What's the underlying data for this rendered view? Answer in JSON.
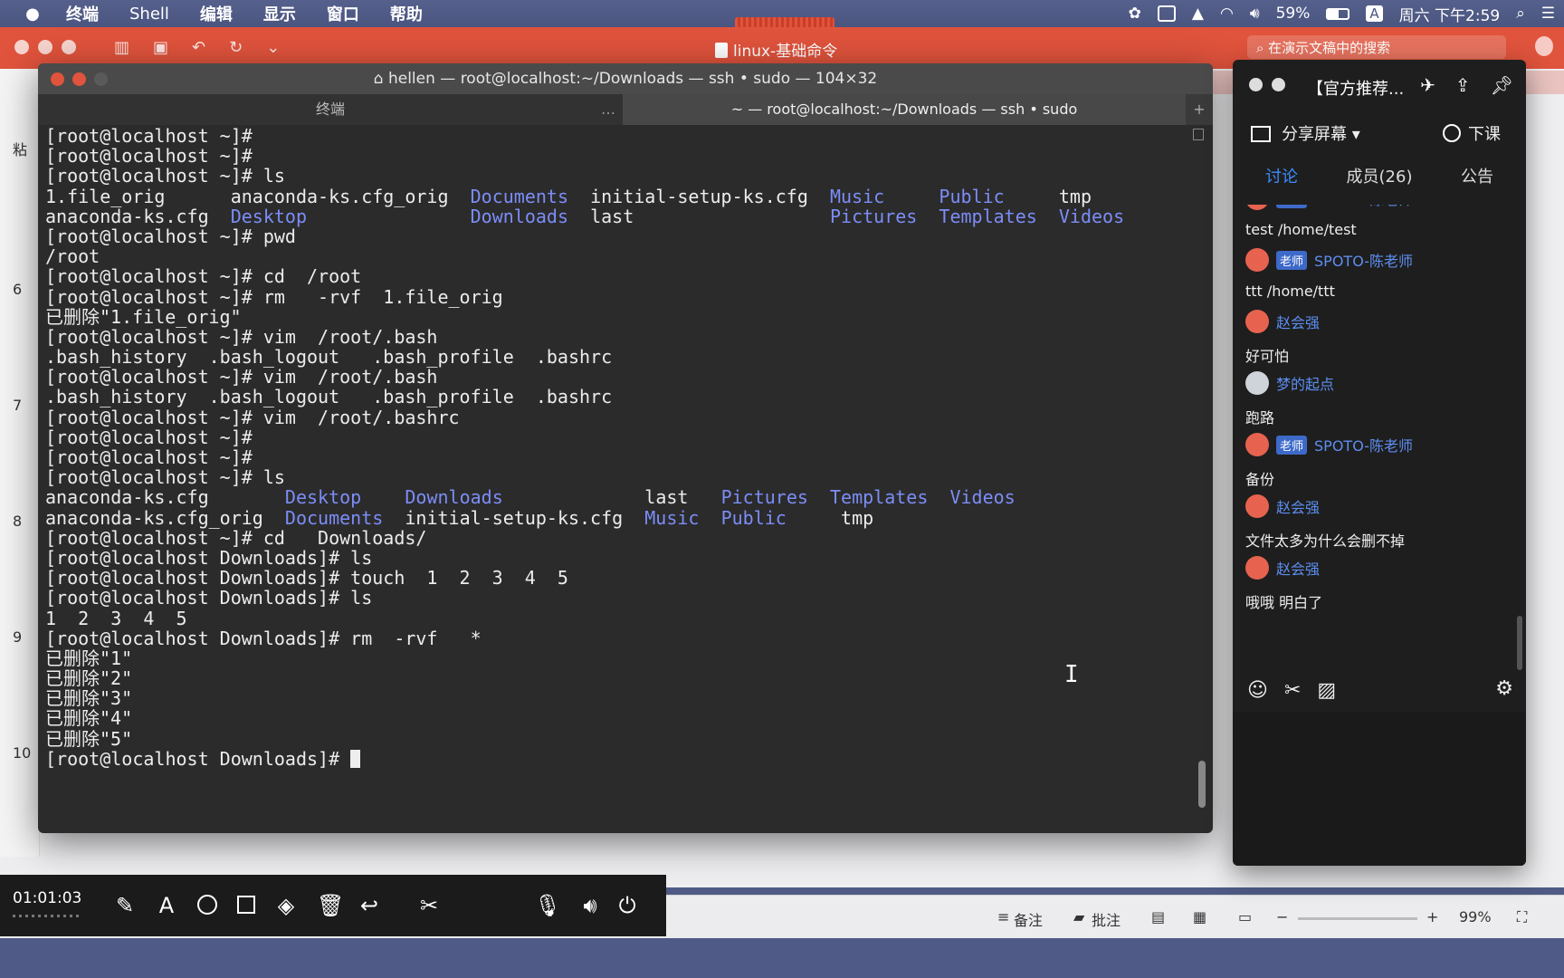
{
  "menubar": {
    "app": "终端",
    "items": [
      "Shell",
      "编辑",
      "显示",
      "窗口",
      "帮助"
    ],
    "battery": "59%",
    "input_method": "A",
    "clock": "周六 下午2:59"
  },
  "doc": {
    "title": "linux-基础命令",
    "search_placeholder": "在演示文稿中的搜索",
    "ruler_numbers": [
      "6",
      "7",
      "8",
      "9",
      "10"
    ],
    "left_char": "粘",
    "bottom": {
      "notes": "备注",
      "comments": "批注",
      "minus": "−",
      "plus": "+",
      "zoom": "99%"
    }
  },
  "terminal": {
    "title": "hellen — root@localhost:~/Downloads — ssh • sudo — 104×32",
    "tab_inactive": "终端",
    "tab_active": "~ — root@localhost:~/Downloads — ssh • sudo",
    "lines": [
      "[root@localhost ~]#",
      "[root@localhost ~]#",
      "[root@localhost ~]# ls",
      "1.file_orig      anaconda-ks.cfg_orig  <D>Documents</D>  initial-setup-ks.cfg  <D>Music</D>     <D>Public</D>     tmp",
      "anaconda-ks.cfg  <D>Desktop</D>               <D>Downloads</D>  last                  <D>Pictures</D>  <D>Templates</D>  <D>Videos</D>",
      "[root@localhost ~]# pwd",
      "/root",
      "[root@localhost ~]# cd  /root",
      "[root@localhost ~]# rm   -rvf  1.file_orig",
      "已删除\"1.file_orig\"",
      "[root@localhost ~]# vim  /root/.bash",
      ".bash_history  .bash_logout   .bash_profile  .bashrc",
      "[root@localhost ~]# vim  /root/.bash",
      ".bash_history  .bash_logout   .bash_profile  .bashrc",
      "[root@localhost ~]# vim  /root/.bashrc",
      "[root@localhost ~]#",
      "[root@localhost ~]#",
      "[root@localhost ~]# ls",
      "anaconda-ks.cfg       <D>Desktop</D>    <D>Downloads</D>             last   <D>Pictures</D>  <D>Templates</D>  <D>Videos</D>",
      "anaconda-ks.cfg_orig  <D>Documents</D>  initial-setup-ks.cfg  <D>Music</D>  <D>Public</D>     tmp",
      "[root@localhost ~]# cd   Downloads/",
      "[root@localhost Downloads]# ls",
      "[root@localhost Downloads]# touch  1  2  3  4  5",
      "[root@localhost Downloads]# ls",
      "1  2  3  4  5",
      "[root@localhost Downloads]# rm  -rvf   *",
      "已删除\"1\"",
      "已删除\"2\"",
      "已删除\"3\"",
      "已删除\"4\"",
      "已删除\"5\"",
      "[root@localhost Downloads]# <CURSOR>"
    ]
  },
  "chat": {
    "title": "【官方推荐...",
    "share_label": "分享屏幕",
    "end_label": "下课",
    "tabs": [
      "讨论",
      "成员(26)",
      "公告"
    ],
    "messages": [
      {
        "badge": "老师",
        "name": "SPOTO-陈老师",
        "text": "test     /home/test"
      },
      {
        "badge": "老师",
        "name": "SPOTO-陈老师",
        "text": "ttt     /home/ttt"
      },
      {
        "badge": "",
        "name": "赵会强",
        "text": "好可怕"
      },
      {
        "badge": "",
        "name": "梦的起点",
        "text": "跑路"
      },
      {
        "badge": "老师",
        "name": "SPOTO-陈老师",
        "text": "备份"
      },
      {
        "badge": "",
        "name": "赵会强",
        "text": "文件太多为什么会删不掉"
      },
      {
        "badge": "",
        "name": "赵会强",
        "text": "哦哦 明白了"
      }
    ]
  },
  "recorder": {
    "time": "01:01:03"
  }
}
